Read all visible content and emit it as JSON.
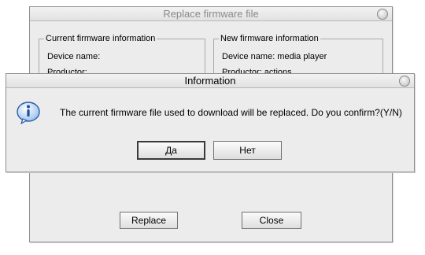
{
  "main_dialog": {
    "title": "Replace firmware file",
    "current": {
      "title": "Current firmware information",
      "device_name": "Device name:",
      "productor": "Productor:"
    },
    "new": {
      "title": "New firmware information",
      "device_name": "Device name: media player",
      "productor": "Productor: actions"
    },
    "replace_label": "Replace",
    "close_label": "Close"
  },
  "info_dialog": {
    "title": "Information",
    "message": "The current firmware file used to download will be replaced. Do you confirm?(Y/N)",
    "yes_label": "Да",
    "no_label": "Нет"
  }
}
